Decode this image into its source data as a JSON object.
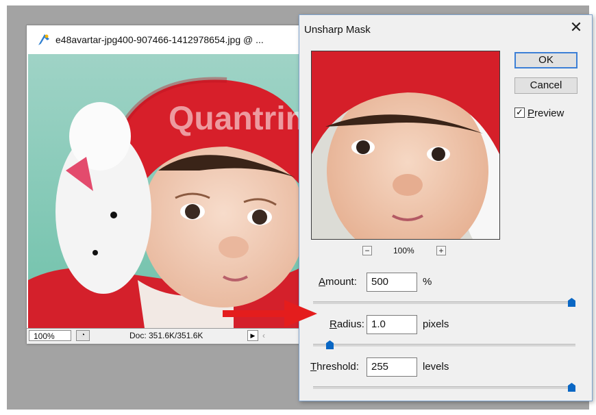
{
  "document_window": {
    "title": "e48avartar-jpg400-907466-1412978654.jpg @ ...",
    "zoom": "100%",
    "doc_info": "Doc: 351.6K/351.6K",
    "watermark": "Quantrimang"
  },
  "dialog": {
    "title": "Unsharp Mask",
    "close": "✕",
    "preview_zoom": "100%",
    "zoom_out": "−",
    "zoom_in": "+",
    "ok_label": "OK",
    "cancel_label": "Cancel",
    "preview": {
      "label_first": "P",
      "label_rest": "review",
      "checked": true
    },
    "amount": {
      "label_first": "A",
      "label_rest": "mount:",
      "value": "500",
      "unit": "%",
      "slider_fraction": 1.0
    },
    "radius": {
      "label_first": "R",
      "label_rest": "adius:",
      "value": "1.0",
      "unit": "pixels",
      "slider_fraction": 0.05
    },
    "threshold": {
      "label_first": "T",
      "label_rest": "hreshold:",
      "value": "255",
      "unit": "levels",
      "slider_fraction": 1.0
    }
  },
  "colors": {
    "accent": "#0078d7",
    "slider_thumb": "#0a67c4",
    "annotation_arrow": "#e41d1d"
  }
}
